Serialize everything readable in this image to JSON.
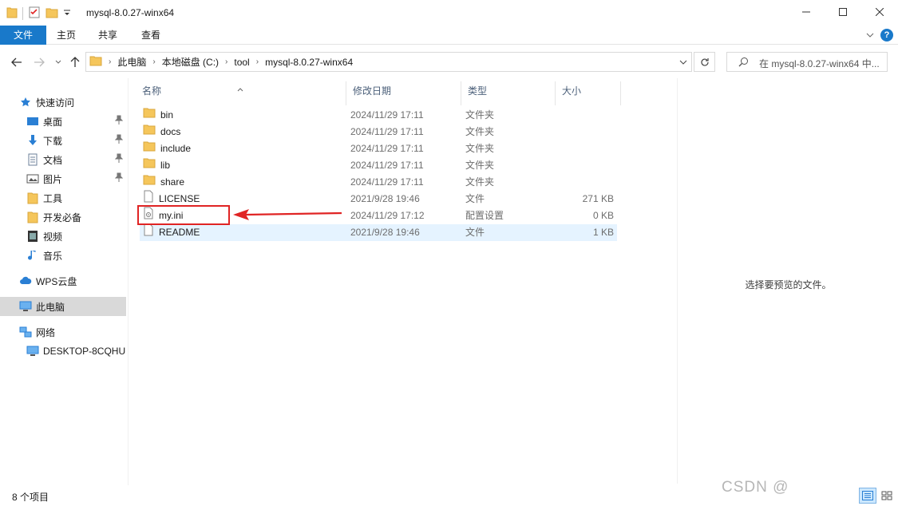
{
  "window": {
    "title": "mysql-8.0.27-winx64",
    "controls": [
      "minimize",
      "maximize",
      "close"
    ]
  },
  "ribbon": {
    "tabs": [
      {
        "label": "文件"
      },
      {
        "label": "主页"
      },
      {
        "label": "共享"
      },
      {
        "label": "查看"
      }
    ]
  },
  "address": {
    "crumbs": [
      "此电脑",
      "本地磁盘 (C:)",
      "tool",
      "mysql-8.0.27-winx64"
    ]
  },
  "search": {
    "placeholder": "在 mysql-8.0.27-winx64 中..."
  },
  "nav_pane": {
    "items": [
      {
        "label": "快速访问",
        "icon": "star-icon"
      },
      {
        "label": "桌面",
        "icon": "desktop-icon",
        "pinned": true
      },
      {
        "label": "下载",
        "icon": "download-icon",
        "pinned": true
      },
      {
        "label": "文档",
        "icon": "document-icon",
        "pinned": true
      },
      {
        "label": "图片",
        "icon": "picture-icon",
        "pinned": true
      },
      {
        "label": "工具",
        "icon": "folder-icon"
      },
      {
        "label": "开发必备",
        "icon": "folder-icon"
      },
      {
        "label": "视频",
        "icon": "video-icon"
      },
      {
        "label": "音乐",
        "icon": "music-icon"
      },
      {
        "label": "WPS云盘",
        "icon": "cloud-icon"
      },
      {
        "label": "此电脑",
        "icon": "computer-icon",
        "selected": true
      },
      {
        "label": "网络",
        "icon": "network-icon"
      },
      {
        "label": "DESKTOP-8CQHU",
        "icon": "monitor-icon"
      }
    ]
  },
  "file_list": {
    "columns": [
      "名称",
      "修改日期",
      "类型",
      "大小"
    ],
    "rows": [
      {
        "name": "bin",
        "date": "2024/11/29 17:11",
        "type": "文件夹",
        "size": "",
        "kind": "folder"
      },
      {
        "name": "docs",
        "date": "2024/11/29 17:11",
        "type": "文件夹",
        "size": "",
        "kind": "folder"
      },
      {
        "name": "include",
        "date": "2024/11/29 17:11",
        "type": "文件夹",
        "size": "",
        "kind": "folder"
      },
      {
        "name": "lib",
        "date": "2024/11/29 17:11",
        "type": "文件夹",
        "size": "",
        "kind": "folder"
      },
      {
        "name": "share",
        "date": "2024/11/29 17:11",
        "type": "文件夹",
        "size": "",
        "kind": "folder"
      },
      {
        "name": "LICENSE",
        "date": "2021/9/28 19:46",
        "type": "文件",
        "size": "271 KB",
        "kind": "file"
      },
      {
        "name": "my.ini",
        "date": "2024/11/29 17:12",
        "type": "配置设置",
        "size": "0 KB",
        "kind": "config"
      },
      {
        "name": "README",
        "date": "2021/9/28 19:46",
        "type": "文件",
        "size": "1 KB",
        "kind": "file"
      }
    ]
  },
  "preview": {
    "message": "选择要预览的文件。"
  },
  "status": {
    "item_count": "8 个项目"
  },
  "watermark": "CSDN @",
  "colors": {
    "accent": "#1979ca",
    "selection": "#d9d9d9",
    "hover_row": "#e5f3ff",
    "annotation_red": "#e02424",
    "folder": "#f5c65b"
  }
}
